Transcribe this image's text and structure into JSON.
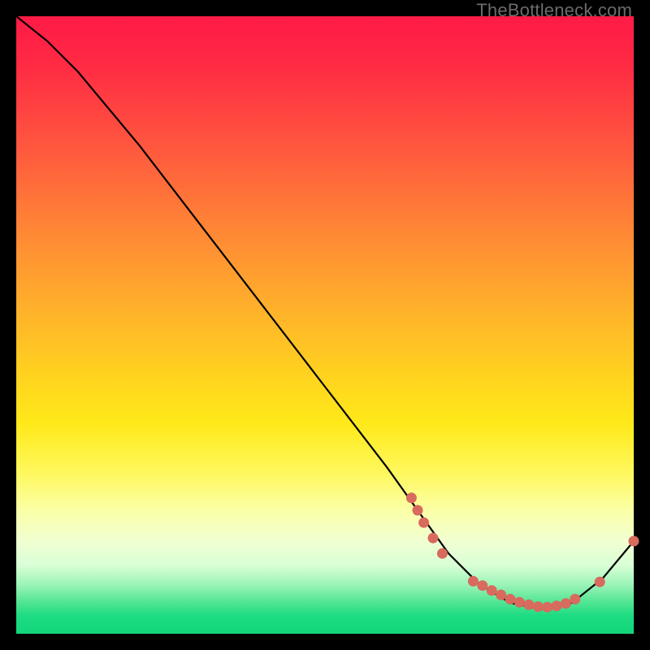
{
  "watermark": "TheBottleneck.com",
  "colors": {
    "frame": "#000000",
    "curve": "#000000",
    "marker": "#d86a5e"
  },
  "chart_data": {
    "type": "line",
    "title": "",
    "xlabel": "",
    "ylabel": "",
    "xlim": [
      0,
      100
    ],
    "ylim": [
      0,
      100
    ],
    "grid": false,
    "legend": false,
    "series": [
      {
        "name": "bottleneck-curve",
        "x": [
          0,
          5,
          10,
          20,
          30,
          40,
          50,
          60,
          65,
          70,
          75,
          80,
          85,
          90,
          95,
          100
        ],
        "y": [
          100,
          96,
          91,
          79,
          66,
          53,
          40,
          27,
          20,
          13,
          8,
          5,
          4,
          5,
          9,
          15
        ]
      }
    ],
    "markers": [
      {
        "x": 64,
        "y": 22
      },
      {
        "x": 65,
        "y": 20
      },
      {
        "x": 66,
        "y": 18
      },
      {
        "x": 67.5,
        "y": 15.5
      },
      {
        "x": 69,
        "y": 13
      },
      {
        "x": 74,
        "y": 8.5
      },
      {
        "x": 75.5,
        "y": 7.8
      },
      {
        "x": 77,
        "y": 7.0
      },
      {
        "x": 78.5,
        "y": 6.3
      },
      {
        "x": 80,
        "y": 5.6
      },
      {
        "x": 81.5,
        "y": 5.1
      },
      {
        "x": 83,
        "y": 4.7
      },
      {
        "x": 84.5,
        "y": 4.4
      },
      {
        "x": 86,
        "y": 4.3
      },
      {
        "x": 87.5,
        "y": 4.5
      },
      {
        "x": 89,
        "y": 4.9
      },
      {
        "x": 90.5,
        "y": 5.6
      },
      {
        "x": 94.5,
        "y": 8.4
      },
      {
        "x": 100,
        "y": 15
      }
    ]
  }
}
